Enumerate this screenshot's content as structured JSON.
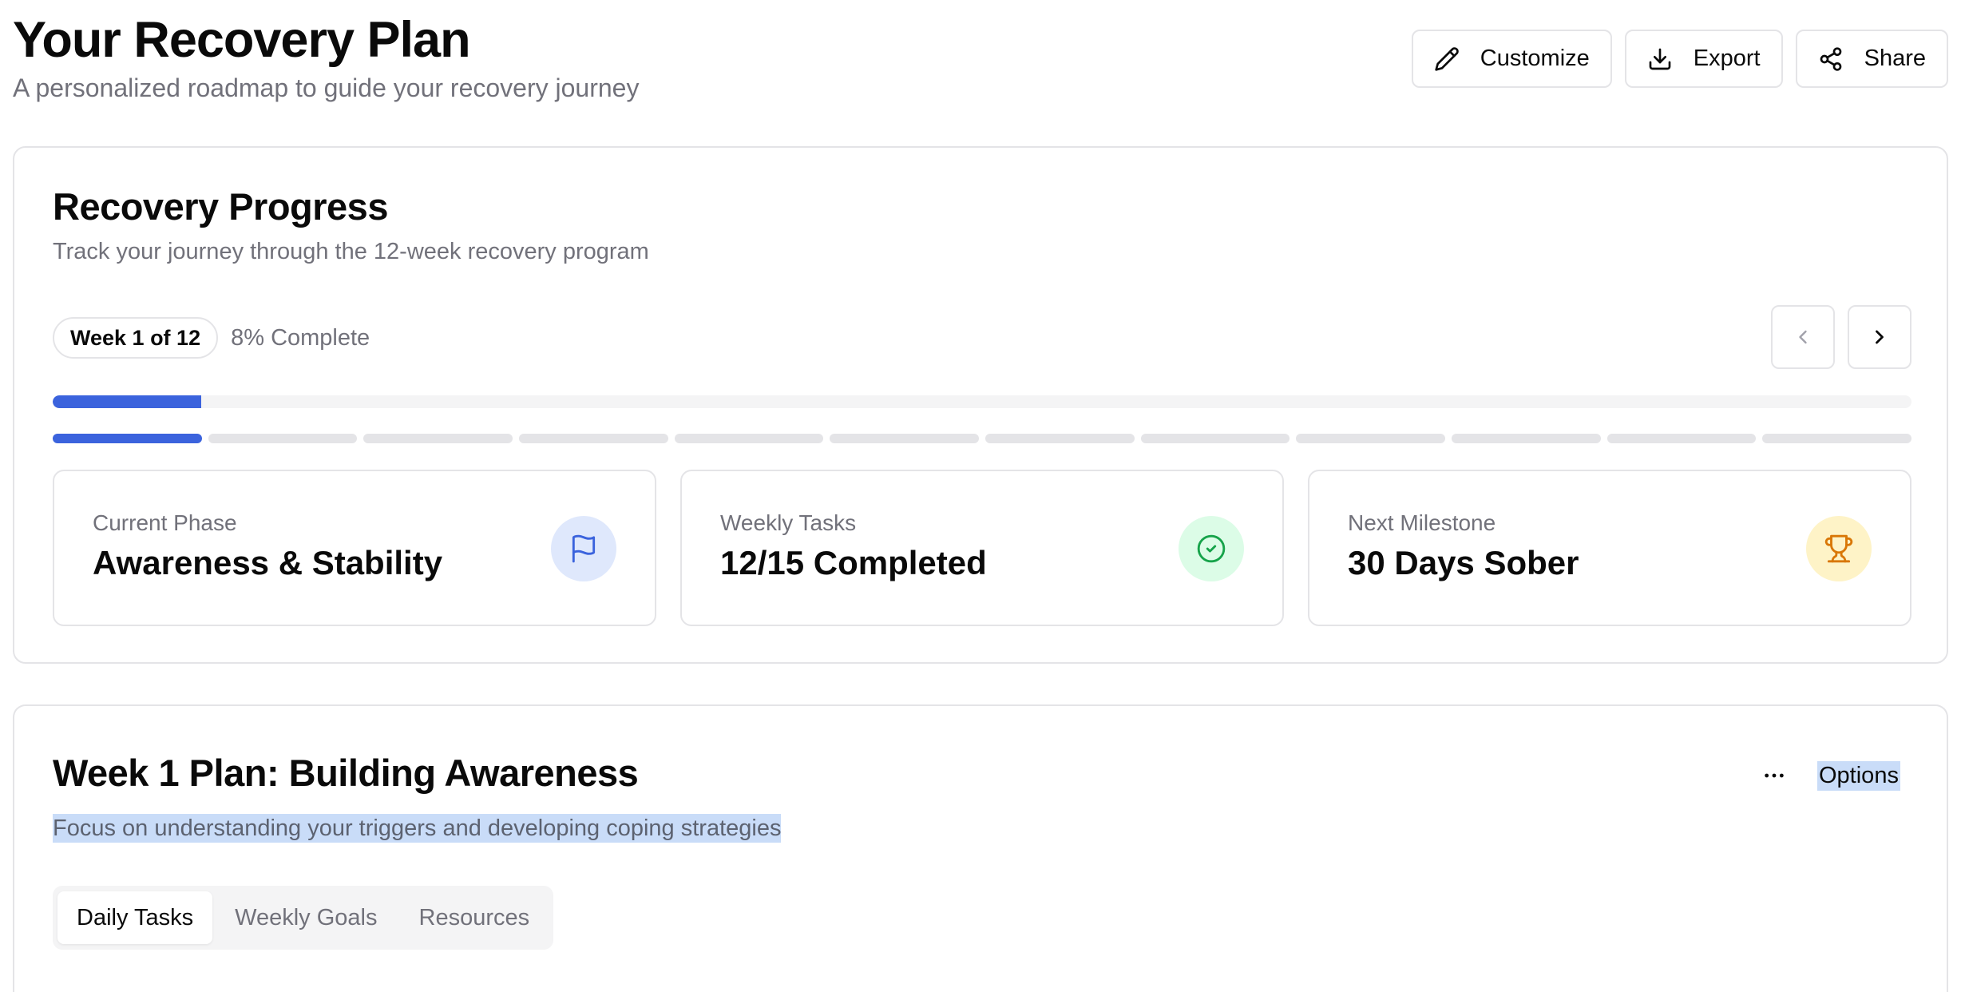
{
  "header": {
    "title": "Your Recovery Plan",
    "subtitle": "A personalized roadmap to guide your recovery journey",
    "actions": [
      {
        "label": "Customize",
        "icon": "pencil-icon"
      },
      {
        "label": "Export",
        "icon": "download-icon"
      },
      {
        "label": "Share",
        "icon": "share-icon"
      }
    ]
  },
  "progress": {
    "title": "Recovery Progress",
    "description": "Track your journey through the 12-week recovery program",
    "week_badge": "Week 1 of 12",
    "complete_text": "8% Complete",
    "percent_complete": 8,
    "current_week": 1,
    "total_weeks": 12,
    "prev_icon": "chevron-left-icon",
    "next_icon": "chevron-right-icon",
    "accent_color": "#3b63dd"
  },
  "stats": [
    {
      "label": "Current Phase",
      "value": "Awareness & Stability",
      "icon": "flag-icon",
      "color": "#3b63dd"
    },
    {
      "label": "Weekly Tasks",
      "value": "12/15 Completed",
      "icon": "check-circle-icon",
      "color": "#16a34a"
    },
    {
      "label": "Next Milestone",
      "value": "30 Days Sober",
      "icon": "trophy-icon",
      "color": "#d97706"
    }
  ],
  "plan": {
    "title": "Week 1 Plan: Building Awareness",
    "description": "Focus on understanding your triggers and developing coping strategies",
    "menu_icon": "more-horizontal-icon",
    "options_label": "Options",
    "tabs": [
      {
        "label": "Daily Tasks",
        "active": true
      },
      {
        "label": "Weekly Goals",
        "active": false
      },
      {
        "label": "Resources",
        "active": false
      }
    ]
  }
}
